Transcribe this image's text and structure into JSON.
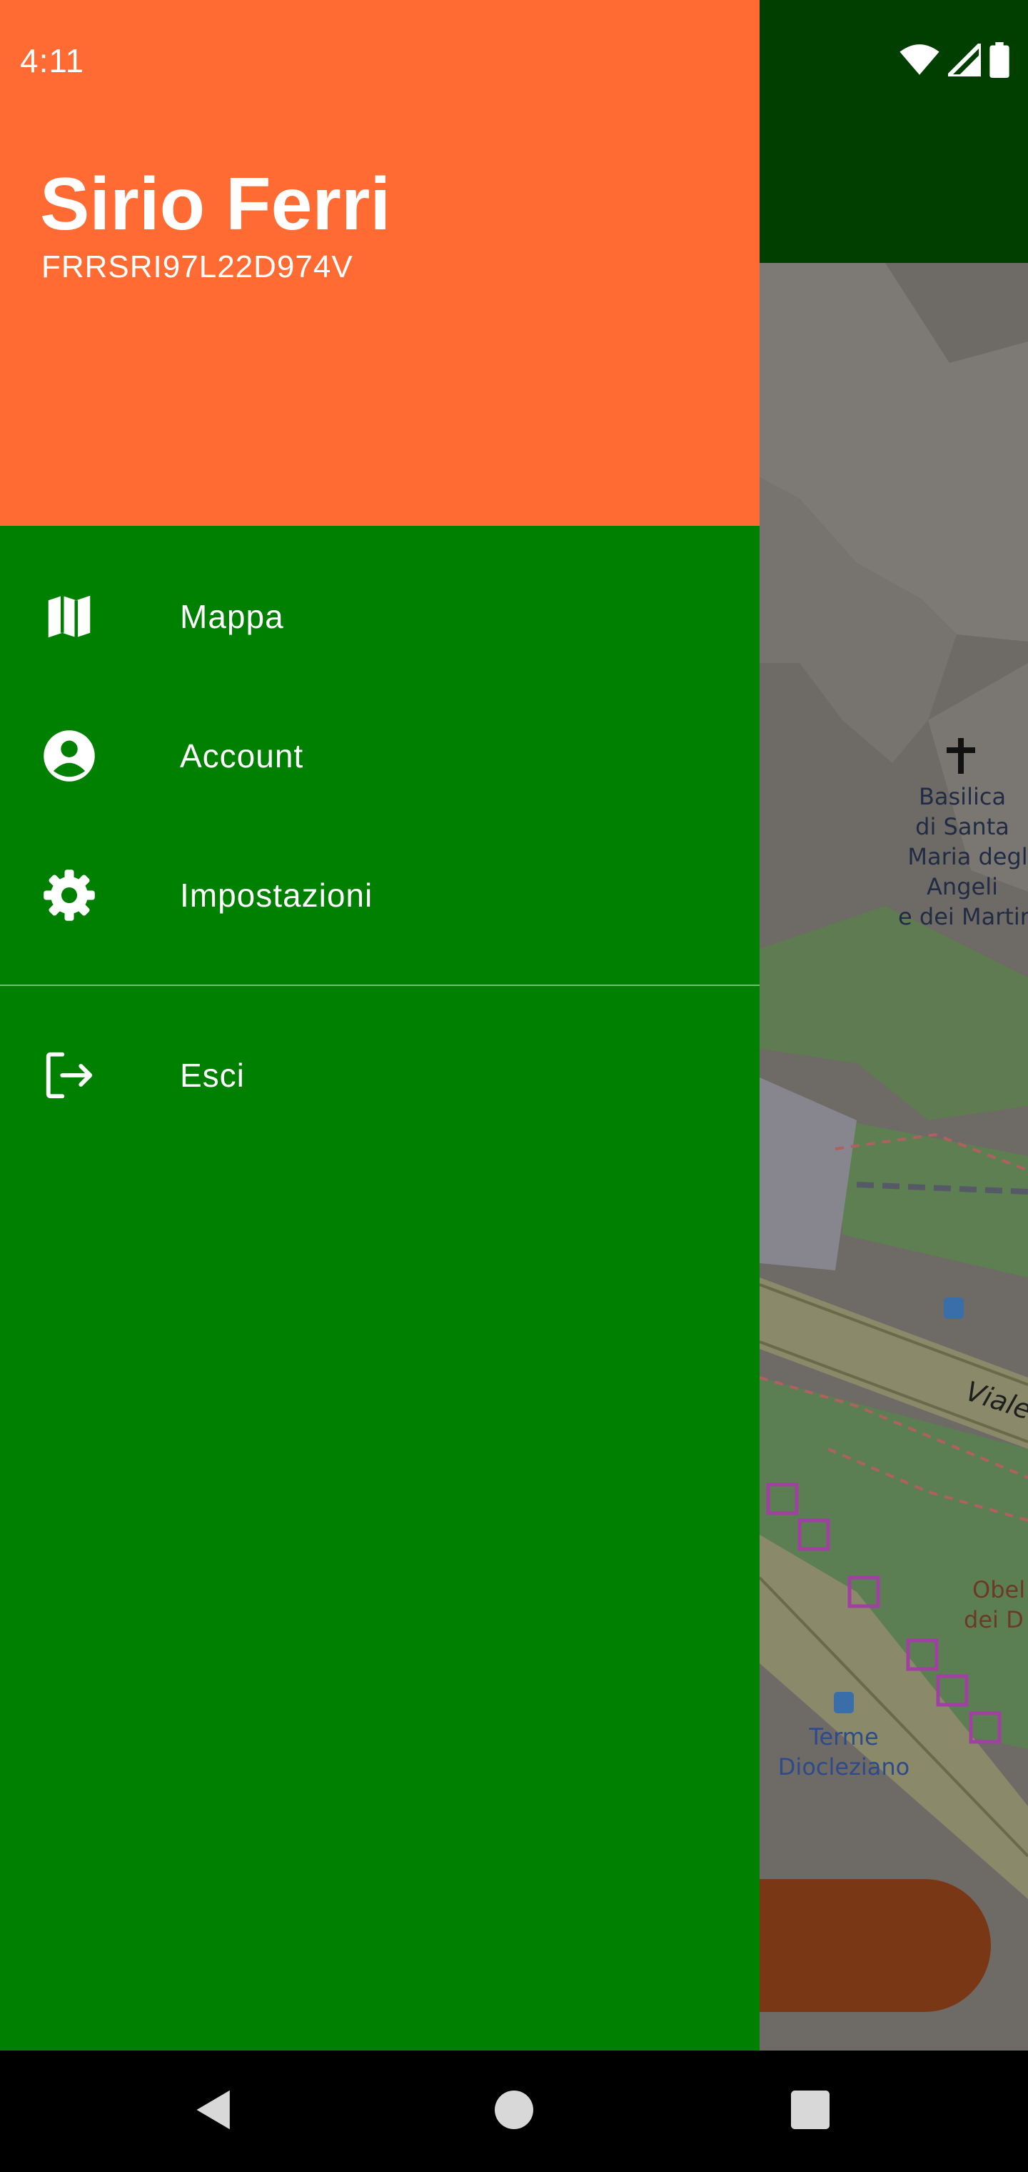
{
  "status_bar": {
    "time": "4:11",
    "icons": [
      "wifi-icon",
      "signal-icon",
      "battery-icon"
    ]
  },
  "drawer": {
    "header": {
      "name": "Sirio Ferri",
      "code": "FRRSRI97L22D974V",
      "background": "#ff6b33"
    },
    "background": "#008000",
    "items": [
      {
        "label": "Mappa",
        "icon": "map-icon"
      },
      {
        "label": "Account",
        "icon": "account-circle-icon"
      },
      {
        "label": "Impostazioni",
        "icon": "gear-icon"
      }
    ],
    "logout": {
      "label": "Esci",
      "icon": "logout-icon"
    }
  },
  "map": {
    "labels": {
      "basilica": [
        "Basilica",
        "di Santa",
        "Maria degli",
        "Angeli",
        "e dei Martir"
      ],
      "street": "Viale",
      "obelisk": [
        "Obel",
        "dei D"
      ],
      "terme": [
        "Terme",
        "Diocleziano"
      ]
    }
  },
  "nav_bar": {
    "buttons": [
      "back-icon",
      "home-icon",
      "recents-icon"
    ]
  }
}
